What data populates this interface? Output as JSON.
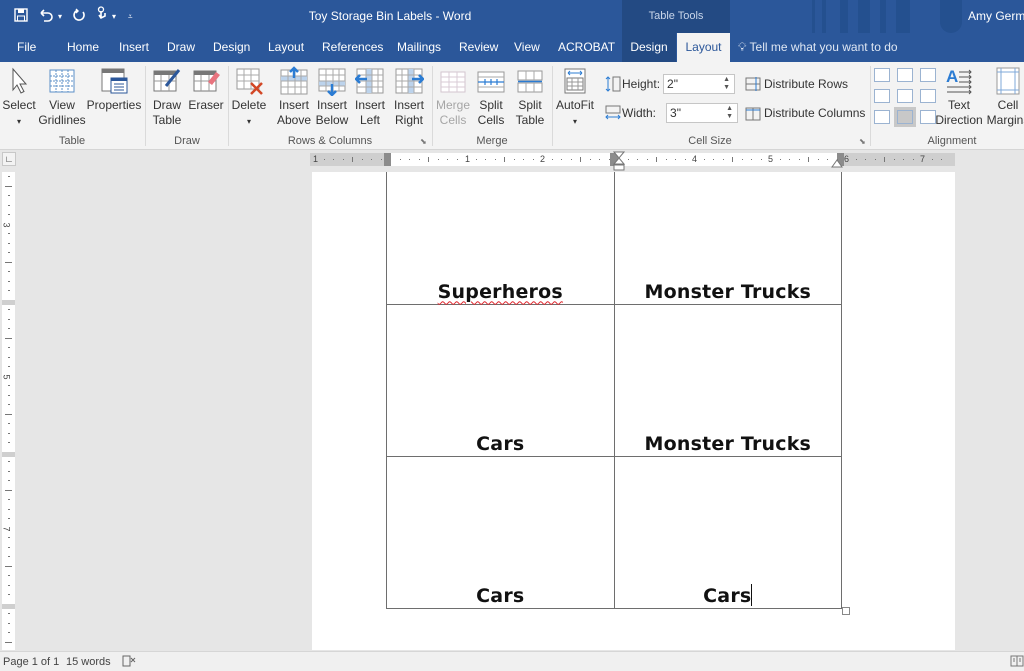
{
  "titlebar": {
    "document_title": "Toy Storage Bin Labels - Word",
    "context_header": "Table Tools",
    "user_name": "Amy Germ",
    "qat": {
      "save_icon": "save-icon",
      "undo_icon": "undo-icon",
      "redo_icon": "redo-icon",
      "touch_icon": "touch-mode-icon",
      "customize_icon": "customize-qat-icon"
    }
  },
  "tabs": [
    {
      "label": "File"
    },
    {
      "label": "Home"
    },
    {
      "label": "Insert"
    },
    {
      "label": "Draw"
    },
    {
      "label": "Design"
    },
    {
      "label": "Layout"
    },
    {
      "label": "References"
    },
    {
      "label": "Mailings"
    },
    {
      "label": "Review"
    },
    {
      "label": "View"
    },
    {
      "label": "ACROBAT"
    },
    {
      "label": "Design"
    },
    {
      "label": "Layout"
    }
  ],
  "active_tab": "Layout",
  "tell_me": {
    "placeholder": "Tell me what you want to do",
    "icon": "lightbulb-icon"
  },
  "ribbon": {
    "groups": {
      "table": "Table",
      "draw": "Draw",
      "rows_columns": "Rows & Columns",
      "merge": "Merge",
      "cell_size": "Cell Size",
      "alignment": "Alignment"
    },
    "buttons": {
      "select": "Select",
      "view_gridlines_1": "View",
      "view_gridlines_2": "Gridlines",
      "properties": "Properties",
      "draw_table_1": "Draw",
      "draw_table_2": "Table",
      "eraser": "Eraser",
      "delete": "Delete",
      "insert_above_1": "Insert",
      "insert_above_2": "Above",
      "insert_below_1": "Insert",
      "insert_below_2": "Below",
      "insert_left_1": "Insert",
      "insert_left_2": "Left",
      "insert_right_1": "Insert",
      "insert_right_2": "Right",
      "merge_cells_1": "Merge",
      "merge_cells_2": "Cells",
      "split_cells_1": "Split",
      "split_cells_2": "Cells",
      "split_table_1": "Split",
      "split_table_2": "Table",
      "autofit": "AutoFit",
      "text_direction_1": "Text",
      "text_direction_2": "Direction",
      "cell_margins_1": "Cell",
      "cell_margins_2": "Margins"
    },
    "cell_size": {
      "height_label": "Height:",
      "height_value": "2\"",
      "width_label": "Width:",
      "width_value": "3\"",
      "distribute_rows": "Distribute Rows",
      "distribute_columns": "Distribute Columns"
    },
    "alignment_selected": "bottom-center"
  },
  "ruler": {
    "horizontal_numbers": [
      "1",
      "1",
      "2",
      "4",
      "5",
      "6",
      "7"
    ],
    "vertical_numbers": [
      "3",
      "5",
      "7"
    ]
  },
  "document": {
    "table": [
      [
        "Superheros",
        "Monster Trucks"
      ],
      [
        "Cars",
        "Monster Trucks"
      ],
      [
        "Cars",
        "Cars"
      ]
    ],
    "misspelled": "Superheros"
  },
  "statusbar": {
    "page": "Page 1 of 1",
    "words": "15 words",
    "proofing_icon": "proofing-icon",
    "read_mode_icon": "read-mode-icon"
  }
}
